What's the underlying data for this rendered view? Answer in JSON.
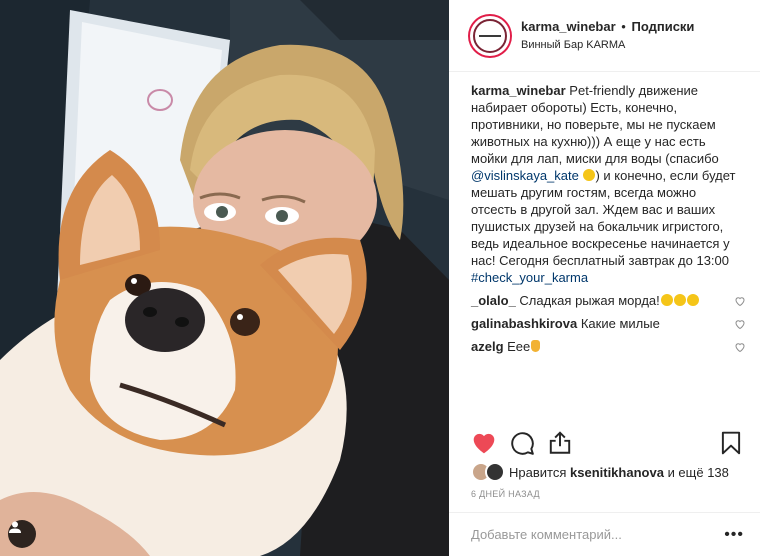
{
  "post": {
    "username": "karma_winebar",
    "separator": "•",
    "follow_label": "Подписки",
    "location": "Винный Бар KARMA"
  },
  "caption": {
    "author": "karma_winebar",
    "text_1": "Pet-friendly движение набирает обороты) Есть, конечно, противники, но поверьте, мы не пускаем животных на кухню))) А еще у нас есть мойки для лап, миски для воды (спасибо ",
    "mention": "@vislinskaya_kate",
    "text_2": ") и конечно, если будет мешать другим гостям, всегда можно отсесть в другой зал. Ждем вас и ваших пушистых друзей на бокальчик игристого, ведь идеальное воскресенье начинается у нас! Сегодня бесплатный завтрак до 13:00",
    "hashtag": "#check_your_karma"
  },
  "comments": [
    {
      "user": "_olalo_",
      "text": "Сладкая рыжая морда!"
    },
    {
      "user": "galinabashkirova",
      "text": "Какие милые"
    },
    {
      "user": "azelg",
      "text": "Еее"
    }
  ],
  "likes": {
    "prefix": "Нравится",
    "user": "ksenitikhanova",
    "suffix": "и ещё 138"
  },
  "timestamp": "6 дней назад",
  "add_comment": {
    "placeholder": "Добавьте комментарий...",
    "more": "•••"
  },
  "icons": {
    "like": "heart-filled-icon",
    "comment": "comment-icon",
    "share": "share-icon",
    "save": "bookmark-icon",
    "comment_like": "heart-outline-icon",
    "user_tag": "user-tag-icon"
  },
  "colors": {
    "like_red": "#ed4956",
    "link_blue": "#00376b",
    "muted": "#8e8e8e"
  }
}
